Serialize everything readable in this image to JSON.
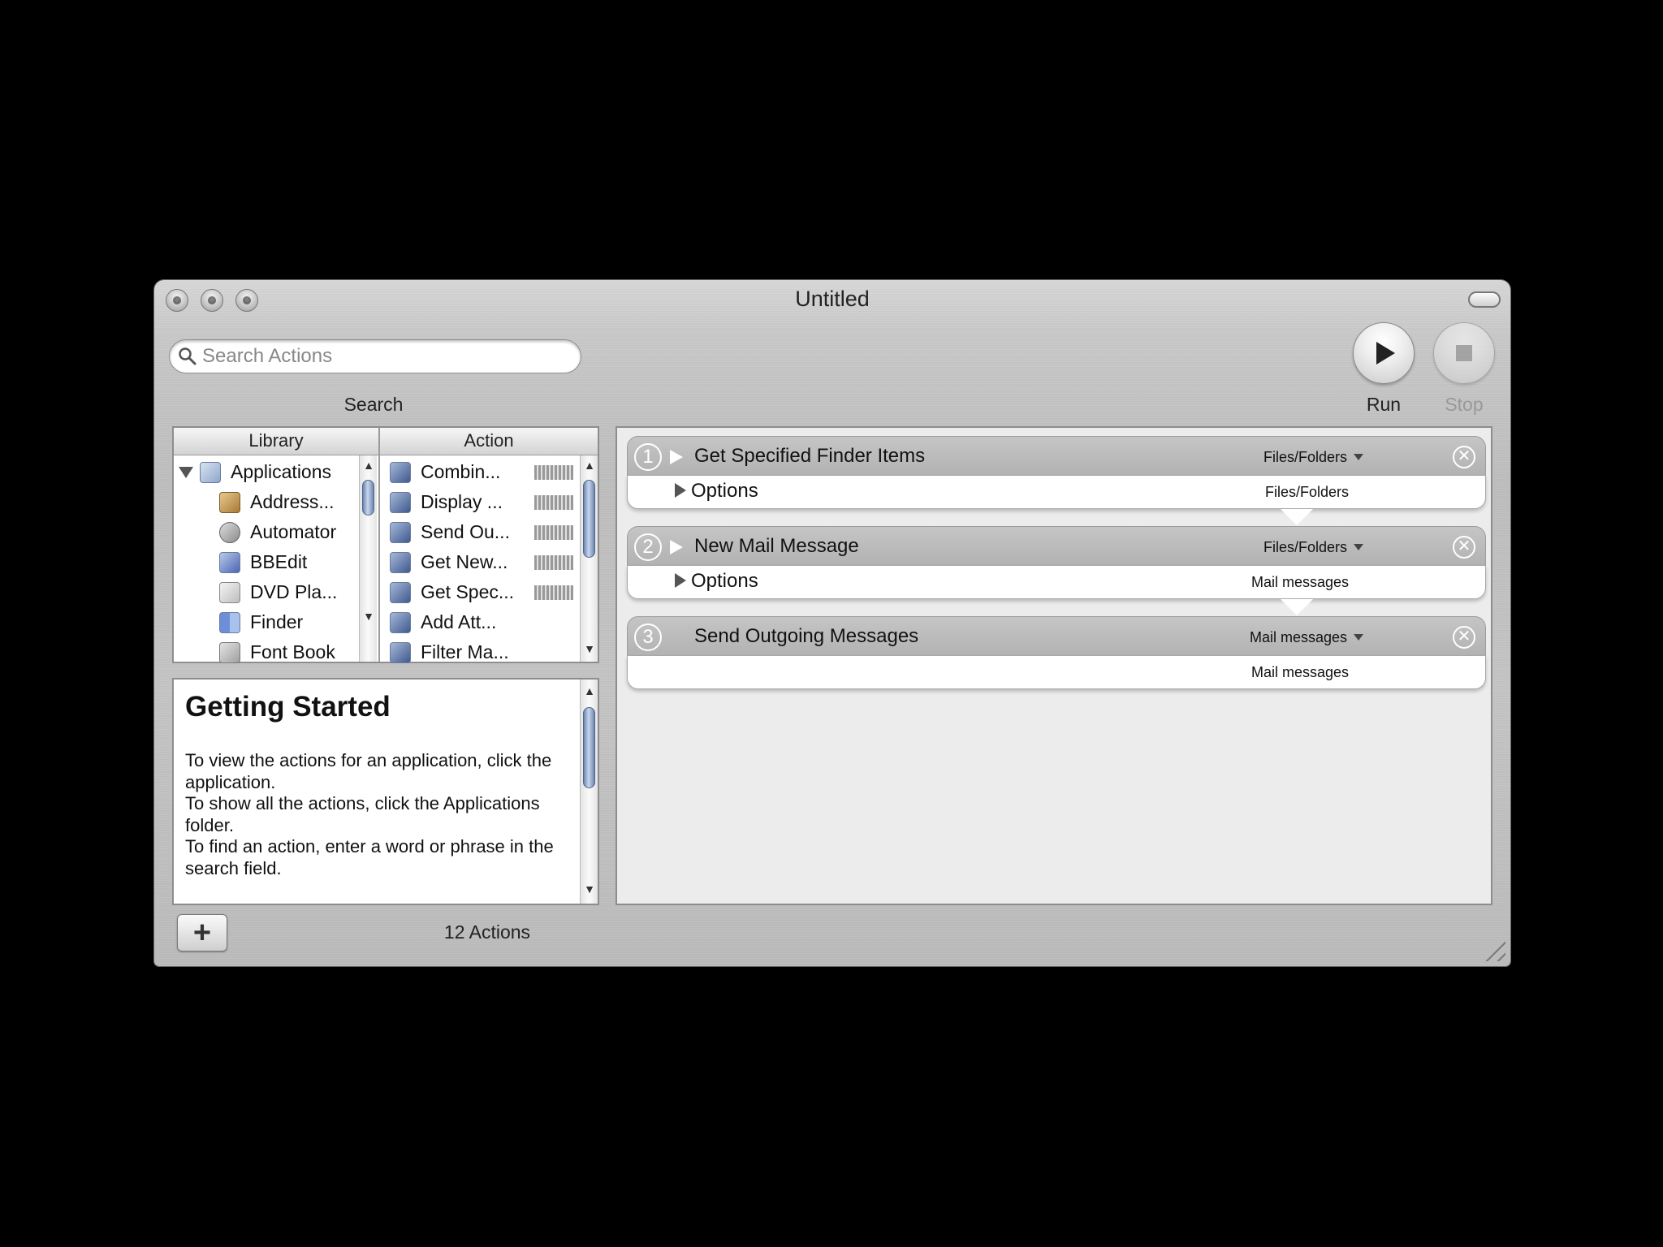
{
  "window": {
    "title": "Untitled"
  },
  "search": {
    "placeholder": "Search Actions",
    "label": "Search"
  },
  "toolbar": {
    "run_label": "Run",
    "stop_label": "Stop"
  },
  "library": {
    "header": "Library",
    "items": [
      {
        "label": "Applications",
        "icon": "applications-folder-icon"
      },
      {
        "label": "Address...",
        "icon": "address-book-icon"
      },
      {
        "label": "Automator",
        "icon": "automator-icon"
      },
      {
        "label": "BBEdit",
        "icon": "bbedit-icon"
      },
      {
        "label": "DVD Pla...",
        "icon": "dvd-player-icon"
      },
      {
        "label": "Finder",
        "icon": "finder-icon"
      },
      {
        "label": "Font Book",
        "icon": "font-book-icon"
      }
    ]
  },
  "actions": {
    "header": "Action",
    "items": [
      {
        "label": "Combin..."
      },
      {
        "label": "Display ..."
      },
      {
        "label": "Send Ou..."
      },
      {
        "label": "Get New..."
      },
      {
        "label": "Get Spec..."
      },
      {
        "label": "Add Att..."
      },
      {
        "label": "Filter Ma..."
      }
    ]
  },
  "description": {
    "title": "Getting Started",
    "paragraphs": [
      "To view the actions for an application, click the application.",
      "To show all the actions, click the Applications folder.",
      "To find an action, enter a word or phrase in the search field."
    ]
  },
  "workflow": [
    {
      "number": "1",
      "title": "Get Specified Finder Items",
      "input_type": "Files/Folders",
      "options_label": "Options",
      "output_type": "Files/Folders"
    },
    {
      "number": "2",
      "title": "New Mail Message",
      "input_type": "Files/Folders",
      "options_label": "Options",
      "output_type": "Mail messages"
    },
    {
      "number": "3",
      "title": "Send Outgoing Messages",
      "input_type": "Mail messages",
      "options_label": "",
      "output_type": "Mail messages"
    }
  ],
  "status": {
    "count": "12 Actions",
    "add_label": "+"
  }
}
